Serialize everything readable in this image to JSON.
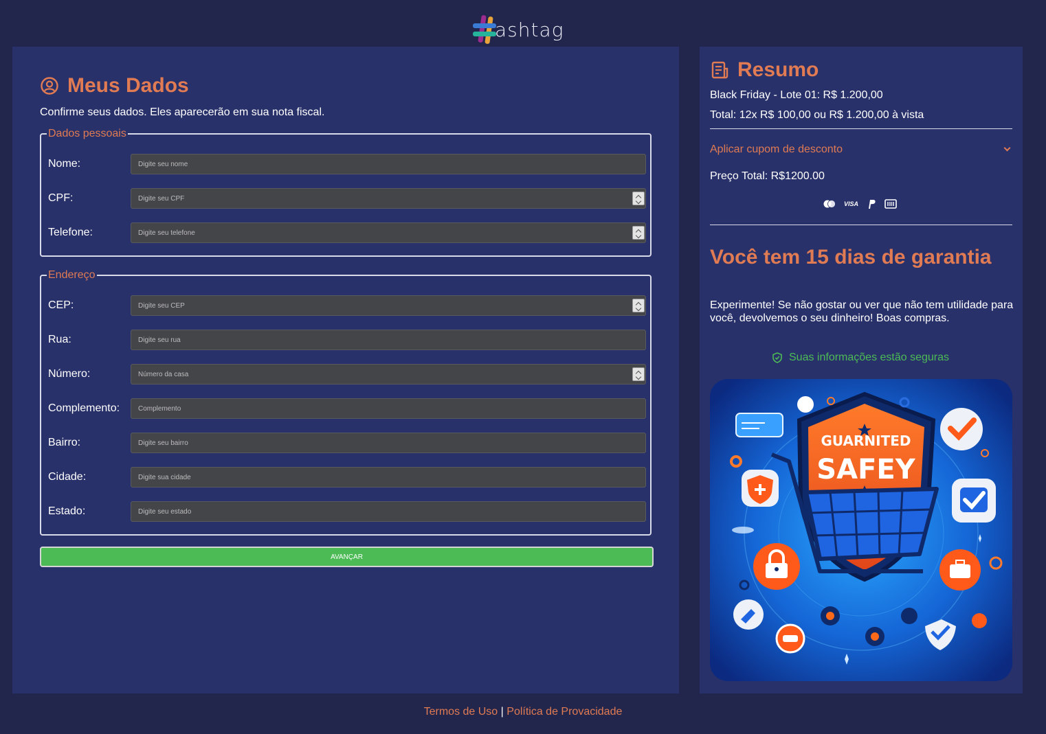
{
  "brand": {
    "logo_text": "ashtag"
  },
  "form": {
    "title": "Meus Dados",
    "subtitle": "Confirme seus dados. Eles aparecerão em sua nota fiscal.",
    "personal": {
      "legend": "Dados pessoais",
      "fields": [
        {
          "label": "Nome:",
          "placeholder": "Digite seu nome"
        },
        {
          "label": "CPF:",
          "placeholder": "Digite seu CPF"
        },
        {
          "label": "Telefone:",
          "placeholder": "Digite seu telefone"
        }
      ]
    },
    "address": {
      "legend": "Endereço",
      "fields": [
        {
          "label": "CEP:",
          "placeholder": "Digite seu CEP"
        },
        {
          "label": "Rua:",
          "placeholder": "Digite seu rua"
        },
        {
          "label": "Número:",
          "placeholder": "Número da casa"
        },
        {
          "label": "Complemento:",
          "placeholder": "Complemento"
        },
        {
          "label": "Bairro:",
          "placeholder": "Digite seu bairro"
        },
        {
          "label": "Cidade:",
          "placeholder": "Digite sua cidade"
        },
        {
          "label": "Estado:",
          "placeholder": "Digite seu estado"
        }
      ]
    },
    "submit_label": "Avançar"
  },
  "summary": {
    "title": "Resumo",
    "item_line": "Black Friday - Lote 01: R$ 1.200,00",
    "total_line": "Total: 12x R$ 100,00 ou R$ 1.200,00 à vista",
    "coupon_label": "Aplicar cupom de desconto",
    "price_total": "Preço Total: R$1200.00",
    "payment_icons": [
      "mastercard-icon",
      "visa-icon",
      "paypal-icon",
      "boleto-icon"
    ],
    "visa_text": "VISA",
    "guarantee_title": "Você tem 15 dias de garantia",
    "guarantee_text": "Experimente! Se não gostar ou ver que não tem utilidade para você, devolvemos o seu dinheiro! Boas compras.",
    "secure_text": "Suas informações estão seguras",
    "promo_image": {
      "shield_top_text": "GUARNITED",
      "shield_main_text": "SAFEY"
    }
  },
  "footer": {
    "terms": "Termos de Uso",
    "separator": "|",
    "privacy": "Política de Provacidade"
  },
  "colors": {
    "background": "#22264c",
    "panel": "#29316a",
    "accent": "#e07b53",
    "success": "#4cbb55",
    "input": "#444549"
  }
}
